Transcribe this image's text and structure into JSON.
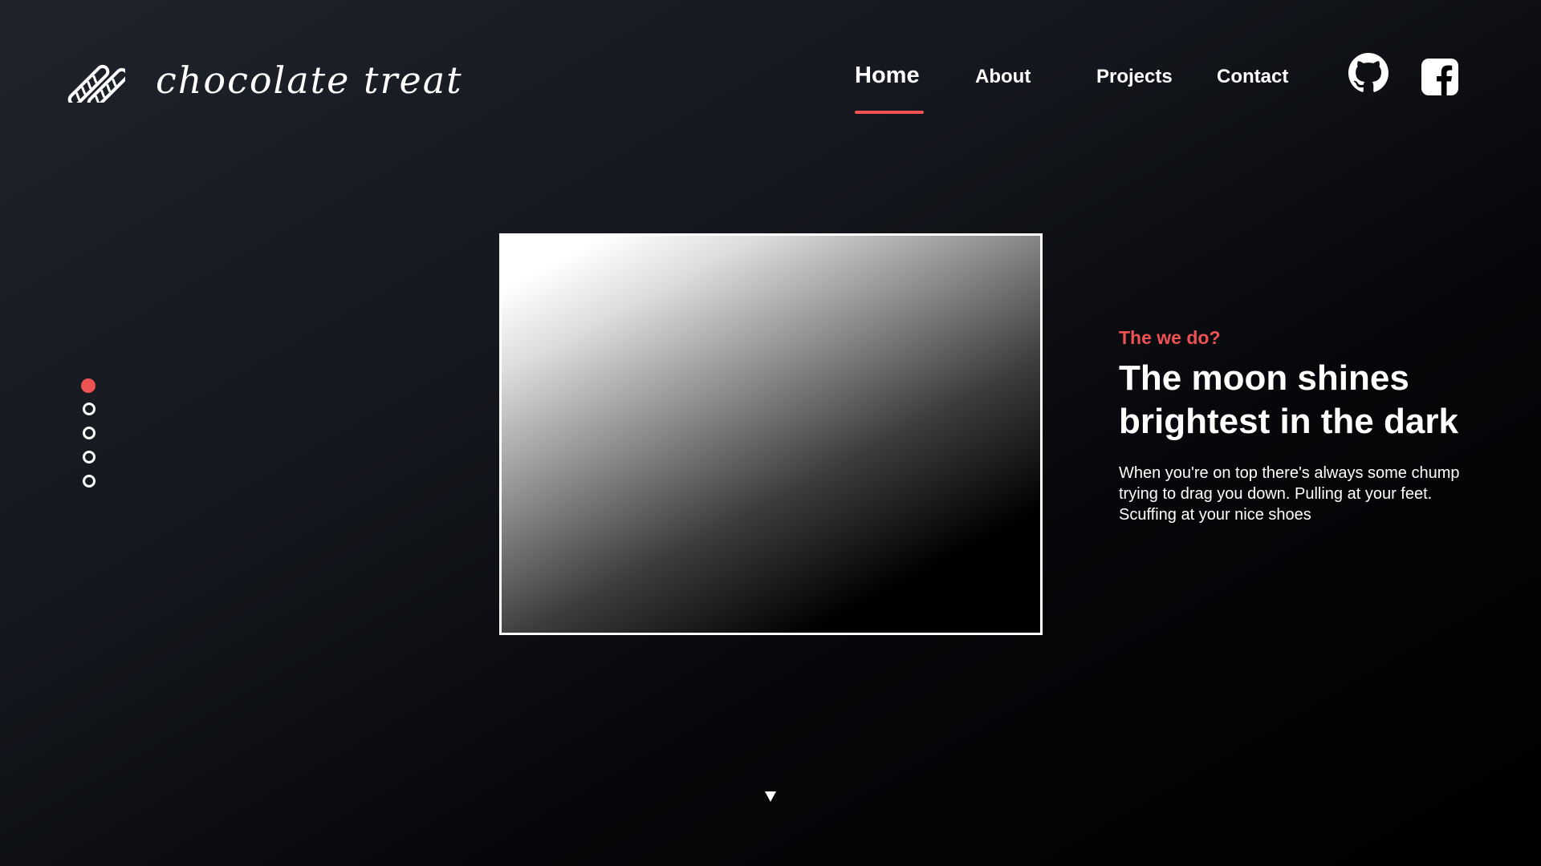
{
  "brand": {
    "name": "chocolate treat",
    "logo_icon": "chocolate-sticks-icon"
  },
  "nav": {
    "items": [
      {
        "label": "Home",
        "active": true
      },
      {
        "label": "About",
        "active": false
      },
      {
        "label": "Projects",
        "active": false
      },
      {
        "label": "Contact",
        "active": false
      }
    ],
    "social": [
      {
        "icon": "github-icon"
      },
      {
        "icon": "facebook-icon"
      }
    ]
  },
  "slider": {
    "count": 5,
    "active_index": 0
  },
  "hero": {
    "eyebrow": "The we do?",
    "headline_line1": "The moon shines",
    "headline_line2": "brightest in the dark",
    "body_line1": "When you're on top there's always some chump",
    "body_line2": "trying to drag you down. Pulling at your feet.",
    "body_line3": "Scuffing at your nice shoes"
  },
  "scroll": {
    "icon": "triangle-down-icon"
  },
  "colors": {
    "accent": "#ee5253",
    "text": "#ffffff",
    "bg_dark": "#000000",
    "bg_light": "#1f232b"
  }
}
